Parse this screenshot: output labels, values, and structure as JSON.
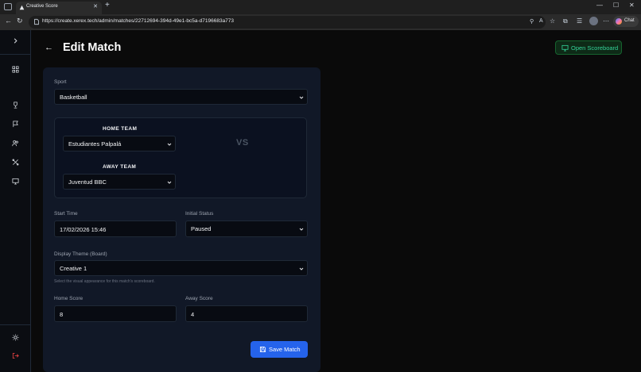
{
  "browser": {
    "tab_title": "Creative Score",
    "url": "https://create.xerex.tech/admin/matches/22712694-394d-49e1-bc5a-d7196683a773",
    "chat_label": "Chat"
  },
  "page": {
    "title": "Edit Match",
    "open_scoreboard_label": "Open Scoreboard"
  },
  "form": {
    "sport_label": "Sport",
    "sport_value": "Basketball",
    "home_team_label": "HOME TEAM",
    "home_team_value": "Estudiantes Palpalá",
    "away_team_label": "AWAY TEAM",
    "away_team_value": "Juventud BBC",
    "vs_label": "VS",
    "start_time_label": "Start Time",
    "start_time_value": "17/02/2026 15:46",
    "initial_status_label": "Initial Status",
    "initial_status_value": "Paused",
    "display_theme_label": "Display Theme (Board)",
    "display_theme_value": "Creative 1",
    "display_theme_help": "Select the visual appearance for this match's scoreboard.",
    "home_score_label": "Home Score",
    "home_score_value": "8",
    "away_score_label": "Away Score",
    "away_score_value": "4",
    "save_label": "Save Match"
  },
  "colors": {
    "accent": "#2563eb",
    "success": "#34d399",
    "background": "#0a0a0a",
    "card": "#111827"
  }
}
